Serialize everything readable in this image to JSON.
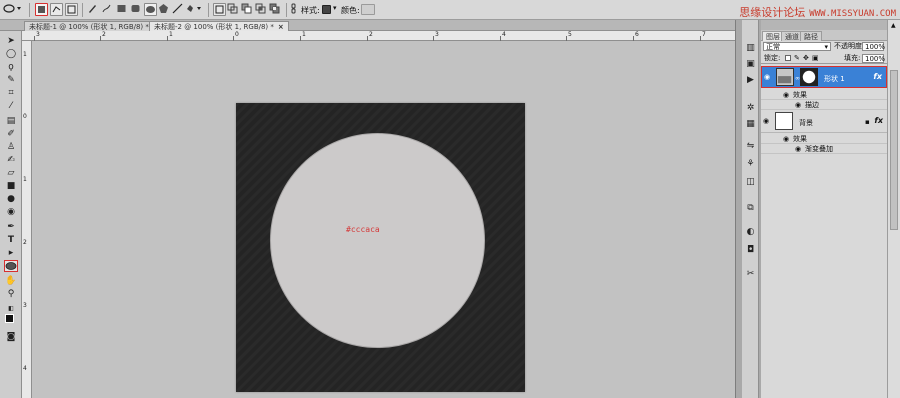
{
  "options_bar": {
    "style_label": "样式:",
    "color_label": "颜色:"
  },
  "watermark": {
    "text": "思缘设计论坛",
    "url": "WWW.MISSYUAN.COM"
  },
  "tabs": [
    {
      "label": "未标题-1 @ 100% (形状 1, RGB/8) *",
      "close": "×"
    },
    {
      "label": "未标题-2 @ 100% (形状 1, RGB/8) *",
      "close": "×"
    }
  ],
  "ruler": {
    "top_labels": [
      "3",
      "2",
      "1",
      "0",
      "1",
      "2",
      "3",
      "4",
      "5",
      "6",
      "7",
      "8"
    ],
    "left_labels": [
      "1",
      "0",
      "1",
      "2",
      "3",
      "4"
    ]
  },
  "canvas": {
    "background_color": "#252525",
    "circle_color": "#cccaca",
    "hex_label": "#cccaca"
  },
  "layers_panel": {
    "tabs": [
      "图层",
      "通道",
      "路径"
    ],
    "blend_mode": "正常",
    "opacity_label": "不透明度:",
    "opacity_value": "100%",
    "lock_label": "锁定:",
    "fill_label": "填充:",
    "fill_value": "100%",
    "layers": [
      {
        "name": "形状 1",
        "fx": "fx",
        "effects_label": "效果",
        "effects": [
          "描边"
        ]
      },
      {
        "name": "背景",
        "fx": "fx",
        "effects_label": "效果",
        "effects": [
          "渐变叠加"
        ]
      }
    ]
  }
}
